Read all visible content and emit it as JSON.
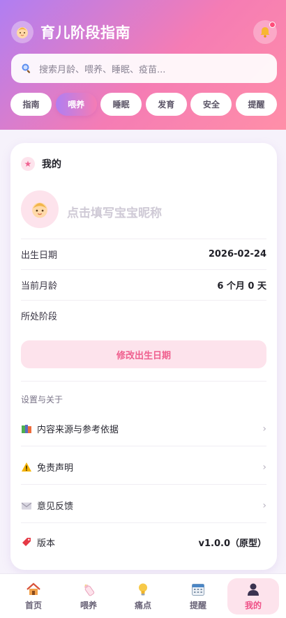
{
  "header": {
    "title": "育儿阶段指南",
    "logo_icon": "baby-face-icon",
    "bell_icon": "bell-icon",
    "search_placeholder": "搜索月龄、喂养、睡眠、疫苗...",
    "tabs": [
      {
        "label": "指南",
        "active": false
      },
      {
        "label": "喂养",
        "active": true
      },
      {
        "label": "睡眠",
        "active": false
      },
      {
        "label": "发育",
        "active": false
      },
      {
        "label": "安全",
        "active": false
      },
      {
        "label": "提醒",
        "active": false
      }
    ]
  },
  "profile": {
    "section_title": "我的",
    "nickname_placeholder": "点击填写宝宝昵称",
    "rows": [
      {
        "label": "出生日期",
        "value": "2026-02-24"
      },
      {
        "label": "当前月龄",
        "value": "6 个月 0 天"
      },
      {
        "label": "所处阶段",
        "value": ""
      }
    ],
    "edit_button": "修改出生日期"
  },
  "settings": {
    "title": "设置与关于",
    "items": [
      {
        "label": "内容来源与参考依据",
        "icon": "books-icon"
      },
      {
        "label": "免责声明",
        "icon": "warning-icon"
      },
      {
        "label": "意见反馈",
        "icon": "envelope-icon"
      }
    ],
    "version_label": "版本",
    "version_value": "v1.0.0（原型）",
    "chevron": "›"
  },
  "nav": {
    "items": [
      {
        "label": "首页",
        "icon": "home-icon",
        "active": false
      },
      {
        "label": "喂养",
        "icon": "bottle-icon",
        "active": false
      },
      {
        "label": "痛点",
        "icon": "lightbulb-icon",
        "active": false
      },
      {
        "label": "提醒",
        "icon": "calendar-icon",
        "active": false
      },
      {
        "label": "我的",
        "icon": "person-icon",
        "active": true
      }
    ]
  },
  "colors": {
    "accent_pink": "#ef5f8e",
    "gradient_start": "#b07ef2",
    "gradient_end": "#ff8fa8"
  }
}
